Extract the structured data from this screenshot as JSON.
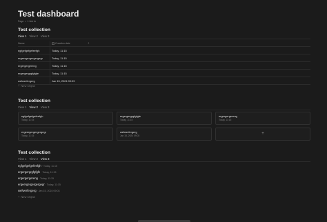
{
  "page": {
    "title": "Test dashboard",
    "meta": [
      "Page",
      "•",
      "1 link to"
    ]
  },
  "table_section": {
    "title": "Test collection",
    "tabs": [
      {
        "label": "View 1",
        "active": true
      },
      {
        "label": "View 2",
        "active": false
      },
      {
        "label": "View 3",
        "active": false
      }
    ],
    "columns": [
      "Name",
      "Creation date",
      "+"
    ],
    "rows": [
      {
        "name": "egfgefgefgefeefgh",
        "date": "Today, 11:15"
      },
      {
        "name": "ergeergergergergegr",
        "date": "Today, 11:15"
      },
      {
        "name": "ergergergereng",
        "date": "Today, 11:15"
      },
      {
        "name": "ergergergrgfgfgfe",
        "date": "Today, 11:15"
      },
      {
        "name": "wefwerfergerg",
        "date": "Jan 15, 2024 09:03"
      }
    ],
    "new_object": "New Object"
  },
  "gallery_section": {
    "title": "Test collection",
    "tabs": [
      {
        "label": "View 1",
        "active": false
      },
      {
        "label": "View 2",
        "active": true
      },
      {
        "label": "View 3",
        "active": false
      }
    ],
    "cards": [
      {
        "title": "egfgefgefgefeefgh",
        "date": "Today, 11:15"
      },
      {
        "title": "ergergergrgfgfgfe",
        "date": "Today, 11:15"
      },
      {
        "title": "ergergergereng",
        "date": "Today, 11:15"
      },
      {
        "title": "ergeergergergergegr",
        "date": "Today, 11:15"
      },
      {
        "title": "wefwerfergerg",
        "date": "Jan 15, 2024 09:03"
      }
    ],
    "add_label": "+"
  },
  "list_section": {
    "title": "Test collection",
    "tabs": [
      {
        "label": "View 1",
        "active": false
      },
      {
        "label": "View 2",
        "active": false
      },
      {
        "label": "View 3",
        "active": true
      }
    ],
    "items": [
      {
        "name": "egfgefgefgefeefgh",
        "date": "· Today, 11:15"
      },
      {
        "name": "ergergergrgfgfgfe",
        "date": "· Today, 11:15"
      },
      {
        "name": "ergergergereng",
        "date": "· Today, 11:15"
      },
      {
        "name": "ergeergergergergegr",
        "date": "· Today, 11:15"
      },
      {
        "name": "wefwerfergerg",
        "date": "· Jan 15, 2024 09:03"
      }
    ],
    "new_object": "New Object"
  },
  "icons": {
    "calendar": "calendar-icon",
    "plus": "plus-icon"
  }
}
